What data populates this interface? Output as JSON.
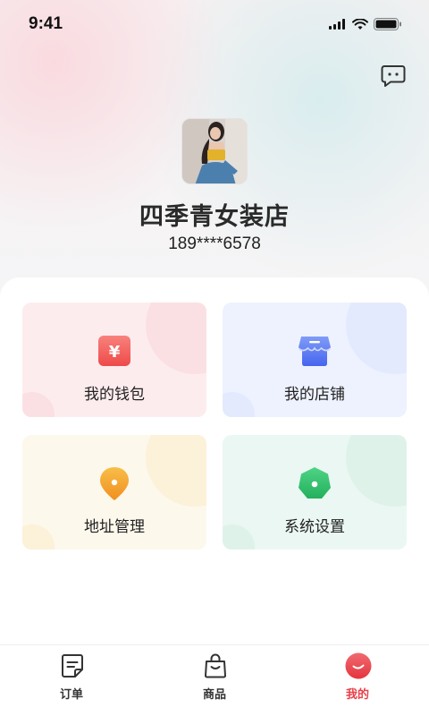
{
  "status_bar": {
    "time": "9:41"
  },
  "header": {
    "message_icon": "message-icon"
  },
  "profile": {
    "shop_name": "四季青女装店",
    "phone": "189****6578"
  },
  "menu": [
    {
      "label": "我的钱包",
      "icon": "wallet-icon",
      "color": "#f0524f"
    },
    {
      "label": "我的店铺",
      "icon": "store-icon",
      "color": "#4a6cf0"
    },
    {
      "label": "地址管理",
      "icon": "location-pin-icon",
      "color": "#f2a020"
    },
    {
      "label": "系统设置",
      "icon": "settings-icon",
      "color": "#2fbf68"
    }
  ],
  "tabbar": [
    {
      "label": "订单",
      "icon": "order-icon",
      "active": false
    },
    {
      "label": "商品",
      "icon": "bag-icon",
      "active": false
    },
    {
      "label": "我的",
      "icon": "profile-smile-icon",
      "active": true
    }
  ],
  "colors": {
    "accent": "#e8404a"
  }
}
